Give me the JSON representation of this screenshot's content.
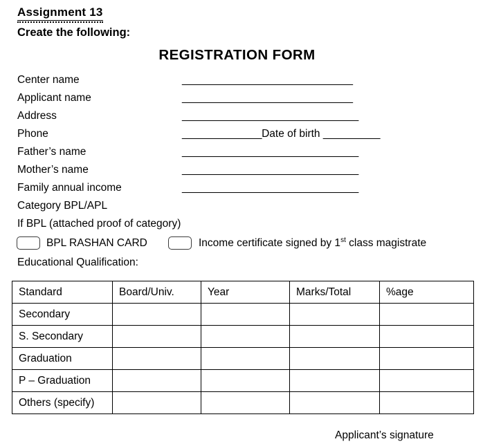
{
  "document": {
    "assignment_title": "Assignment 13",
    "instruction": "Create the following:",
    "form_title": "REGISTRATION FORM"
  },
  "fields": [
    {
      "label": "Center name",
      "rule_before": "______________________________",
      "mid_label": "",
      "rule_after": ""
    },
    {
      "label": "Applicant name",
      "rule_before": "______________________________",
      "mid_label": "",
      "rule_after": ""
    },
    {
      "label": "Address",
      "rule_before": "_______________________________",
      "mid_label": "",
      "rule_after": ""
    },
    {
      "label": "Phone",
      "rule_before": "______________",
      "mid_label": "Date of birth ",
      "rule_after": "__________"
    },
    {
      "label": "Father’s name",
      "rule_before": "_______________________________",
      "mid_label": "",
      "rule_after": ""
    },
    {
      "label": "Mother’s name",
      "rule_before": "_______________________________",
      "mid_label": "",
      "rule_after": ""
    },
    {
      "label": "Family annual income",
      "rule_before": "_______________________________",
      "mid_label": "",
      "rule_after": ""
    },
    {
      "label": "Category BPL/APL",
      "rule_before": "",
      "mid_label": "",
      "rule_after": ""
    },
    {
      "label": "If BPL (attached proof of category)",
      "rule_before": "",
      "mid_label": "",
      "rule_after": ""
    }
  ],
  "checkboxes": {
    "option_1_label": "BPL RASHAN CARD",
    "option_2_prefix": "Income certificate signed by 1",
    "option_2_superscript": "st",
    "option_2_suffix": " class magistrate"
  },
  "education": {
    "section_label": "Educational Qualification:",
    "columns": [
      "Standard",
      "Board/Univ.",
      "Year",
      "Marks/Total",
      "%age"
    ],
    "rows": [
      {
        "standard": "Secondary",
        "board": "",
        "year": "",
        "marks": "",
        "percent": ""
      },
      {
        "standard": "S. Secondary",
        "board": "",
        "year": "",
        "marks": "",
        "percent": ""
      },
      {
        "standard": "Graduation",
        "board": "",
        "year": "",
        "marks": "",
        "percent": ""
      },
      {
        "standard": "P – Graduation",
        "board": "",
        "year": "",
        "marks": "",
        "percent": ""
      },
      {
        "standard": "Others (specify)",
        "board": "",
        "year": "",
        "marks": "",
        "percent": ""
      }
    ]
  },
  "footer": {
    "signature_label": "Applicant’s signature"
  }
}
